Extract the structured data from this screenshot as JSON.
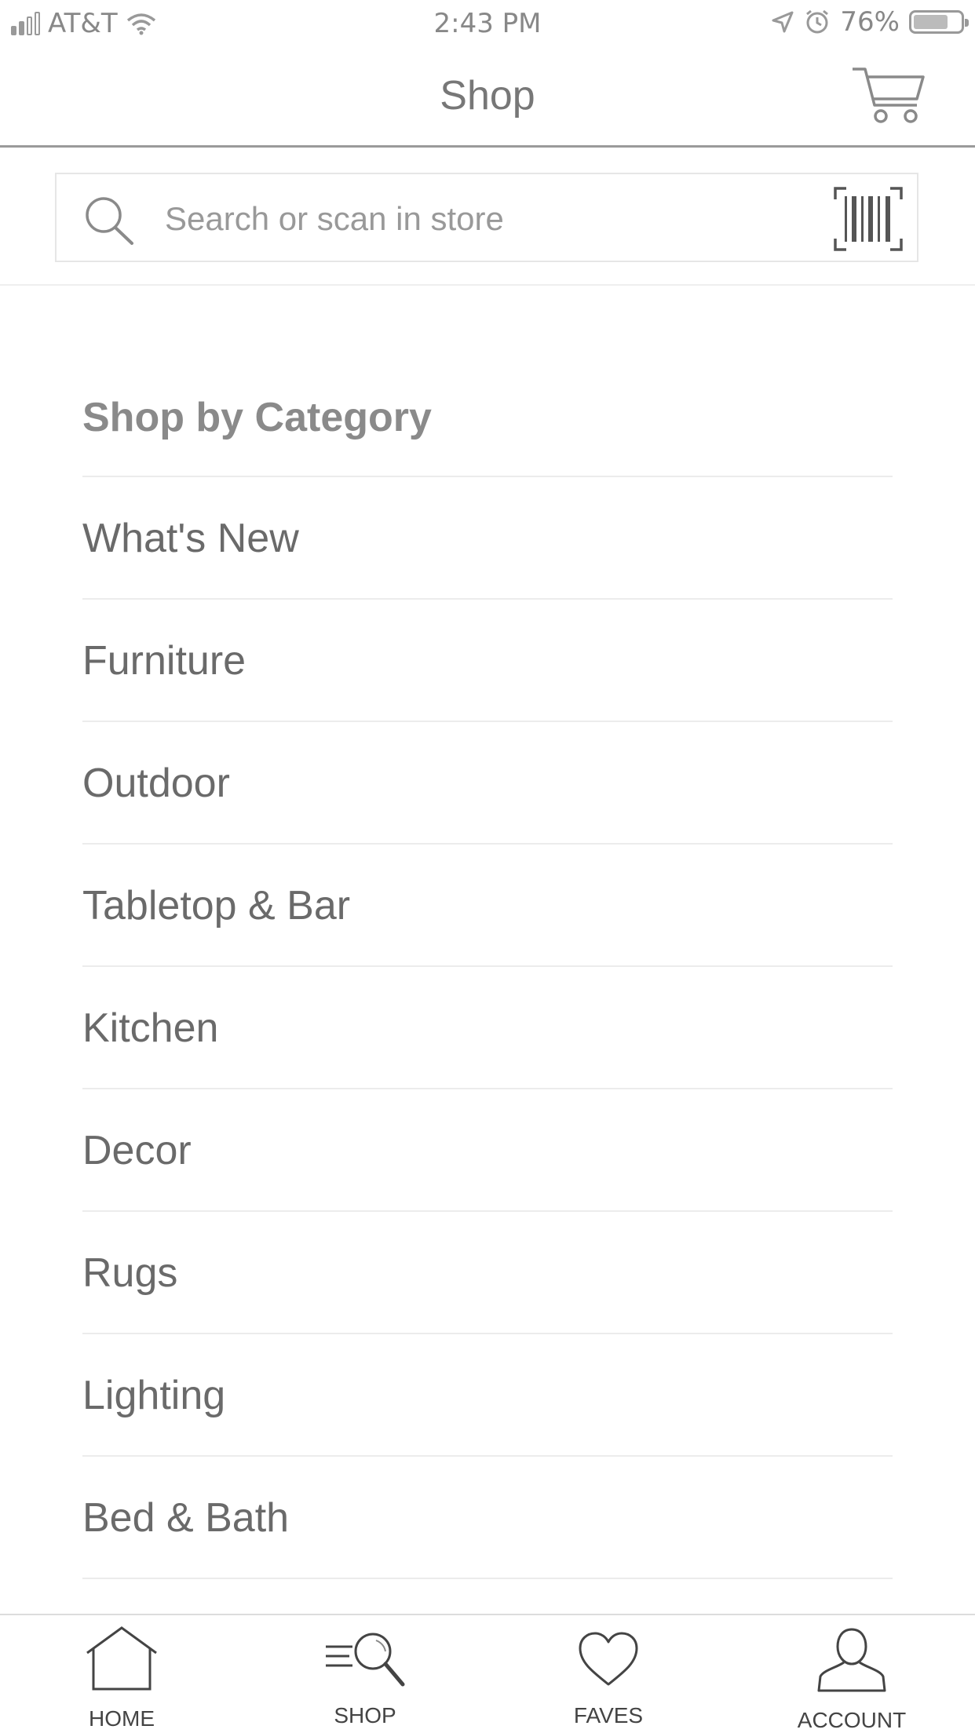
{
  "status_bar": {
    "carrier": "AT&T",
    "time": "2:43 PM",
    "battery": "76%",
    "battery_level": 0.76
  },
  "nav": {
    "title": "Shop",
    "cart_icon": "shopping-cart-icon"
  },
  "search": {
    "placeholder": "Search or scan in store",
    "value": "",
    "search_icon": "search-icon",
    "scan_icon": "barcode-scan-icon"
  },
  "categories": {
    "title": "Shop by Category",
    "items": [
      {
        "label": "What's New"
      },
      {
        "label": "Furniture"
      },
      {
        "label": "Outdoor"
      },
      {
        "label": "Tabletop & Bar"
      },
      {
        "label": "Kitchen"
      },
      {
        "label": "Decor"
      },
      {
        "label": "Rugs"
      },
      {
        "label": "Lighting"
      },
      {
        "label": "Bed & Bath"
      }
    ]
  },
  "tab_bar": {
    "home": {
      "label": "HOME",
      "icon": "home-icon"
    },
    "shop": {
      "label": "SHOP",
      "icon": "shop-search-icon"
    },
    "faves": {
      "label": "FAVES",
      "icon": "heart-icon"
    },
    "account": {
      "label": "ACCOUNT",
      "icon": "person-icon"
    }
  }
}
